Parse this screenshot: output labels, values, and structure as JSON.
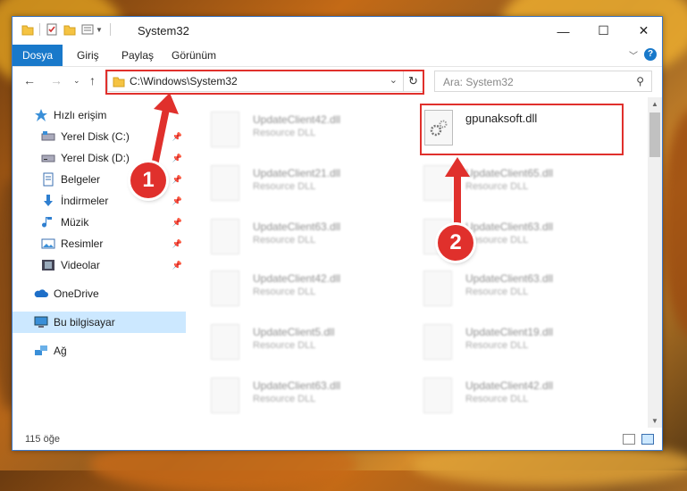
{
  "window": {
    "title": "System32",
    "controls": {
      "minimize": "—",
      "maximize": "☐",
      "close": "✕"
    }
  },
  "ribbon": {
    "tabs": [
      "Dosya",
      "Giriş",
      "Paylaş",
      "Görünüm"
    ],
    "expand_icon": "chevron-down-icon",
    "help": "?"
  },
  "nav": {
    "address": "C:\\Windows\\System32",
    "search_placeholder": "Ara: System32"
  },
  "sidebar": {
    "items": [
      {
        "label": "Hızlı erişim",
        "icon": "star-icon",
        "pinned": false
      },
      {
        "label": "Yerel Disk (C:)",
        "icon": "drive-icon",
        "pinned": true
      },
      {
        "label": "Yerel Disk (D:)",
        "icon": "drive-icon",
        "pinned": true
      },
      {
        "label": "Belgeler",
        "icon": "documents-icon",
        "pinned": true
      },
      {
        "label": "İndirmeler",
        "icon": "download-icon",
        "pinned": true
      },
      {
        "label": "Müzik",
        "icon": "music-icon",
        "pinned": true
      },
      {
        "label": "Resimler",
        "icon": "pictures-icon",
        "pinned": true
      },
      {
        "label": "Videolar",
        "icon": "video-icon",
        "pinned": true
      },
      {
        "label": "OneDrive",
        "icon": "cloud-icon",
        "pinned": false
      },
      {
        "label": "Bu bilgisayar",
        "icon": "computer-icon",
        "pinned": false,
        "selected": true
      },
      {
        "label": "Ağ",
        "icon": "network-icon",
        "pinned": false
      }
    ]
  },
  "files": {
    "highlighted": {
      "name": "gpunaksoft.dll"
    },
    "left_column": [
      {
        "name": "UpdateClient42.dll",
        "type": "Resource DLL"
      },
      {
        "name": "UpdateClient21.dll",
        "type": "Resource DLL"
      },
      {
        "name": "UpdateClient63.dll",
        "type": "Resource DLL"
      },
      {
        "name": "UpdateClient42.dll",
        "type": "Resource DLL"
      },
      {
        "name": "UpdateClient5.dll",
        "type": "Resource DLL"
      },
      {
        "name": "UpdateClient63.dll",
        "type": "Resource DLL"
      }
    ],
    "right_column": [
      {
        "name": "UpdateClient65.dll",
        "type": "Resource DLL"
      },
      {
        "name": "UpdateClient63.dll",
        "type": "Resource DLL"
      },
      {
        "name": "UpdateClient63.dll",
        "type": "Resource DLL"
      },
      {
        "name": "UpdateClient19.dll",
        "type": "Resource DLL"
      },
      {
        "name": "UpdateClient42.dll",
        "type": "Resource DLL"
      }
    ]
  },
  "status": {
    "count": "115 öğe"
  },
  "annotations": {
    "step1": "1",
    "step2": "2",
    "color": "#e0302c"
  }
}
